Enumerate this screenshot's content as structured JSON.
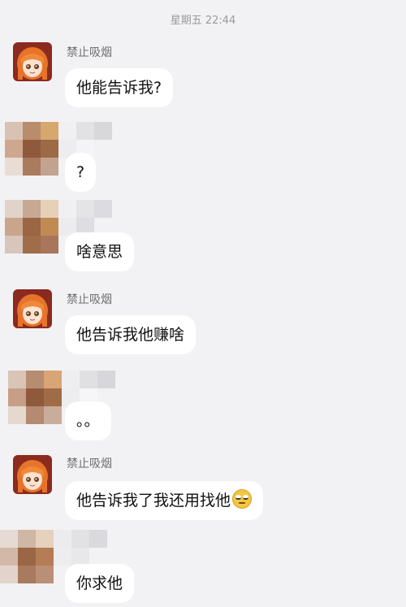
{
  "timestamp": "星期五 22:44",
  "messages": [
    {
      "sender": "禁止吸烟",
      "text": "他能告诉我?"
    },
    {
      "sender": "",
      "text": "?"
    },
    {
      "sender": "",
      "text": "啥意思"
    },
    {
      "sender": "禁止吸烟",
      "text": "他告诉我他赚啥"
    },
    {
      "sender": "",
      "text": "。。"
    },
    {
      "sender": "禁止吸烟",
      "text": "他告诉我了我还用找他"
    },
    {
      "sender": "",
      "text": "你求他"
    }
  ],
  "icons": {
    "emoji": "eye-roll-emoji-icon",
    "avatar": "anime-girl-avatar"
  },
  "colors": {
    "background": "#f2f2f4",
    "bubble": "#ffffff",
    "sender_name": "#6e6e73"
  }
}
